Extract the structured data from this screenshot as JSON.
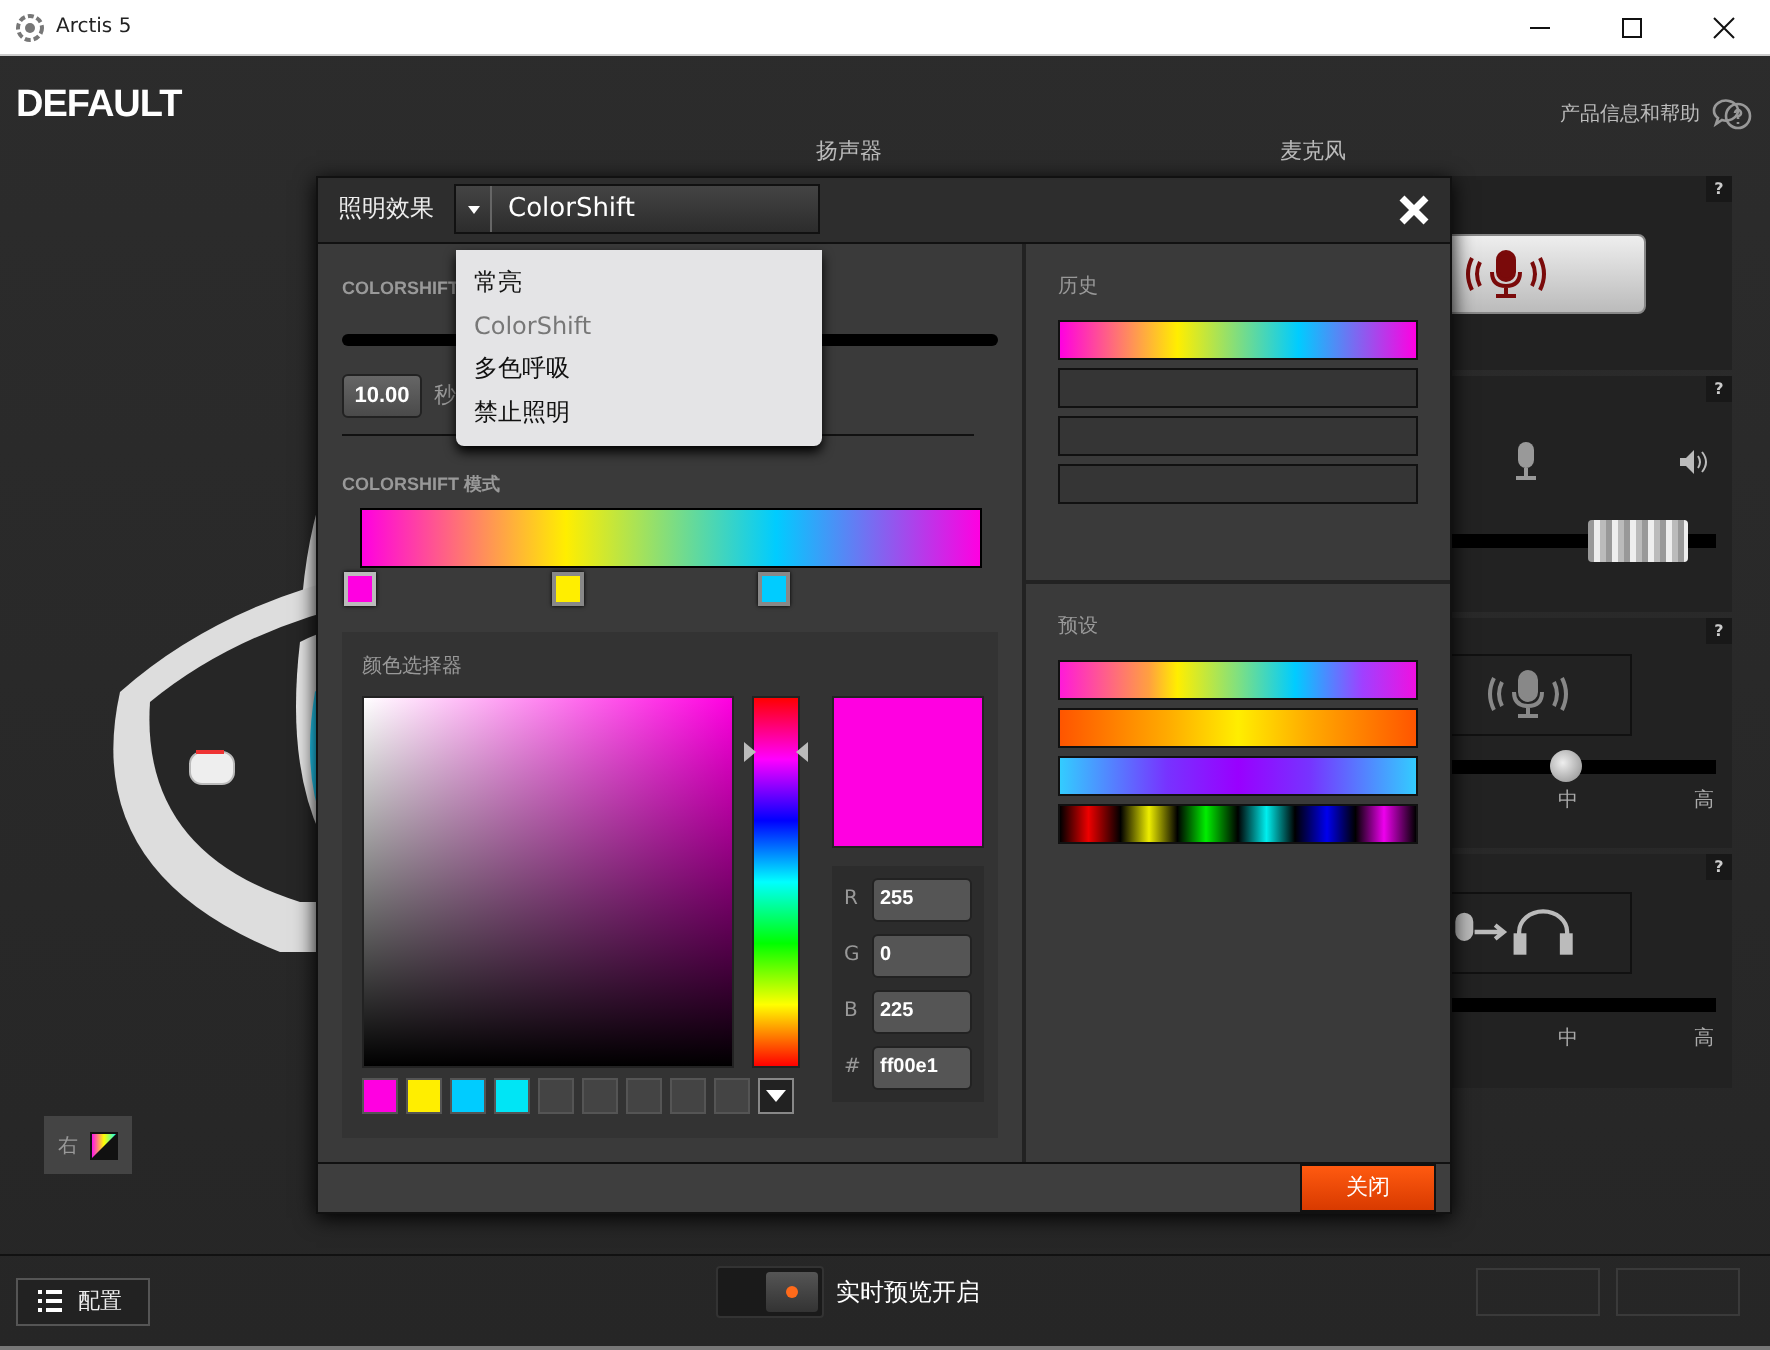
{
  "window": {
    "title": "Arctis 5"
  },
  "profile": {
    "name": "DEFAULT"
  },
  "help_link": "产品信息和帮助",
  "column_headings": [
    "扬声器",
    "麦克风"
  ],
  "mic_panels": [
    {
      "kind": "mute",
      "help": "?"
    },
    {
      "kind": "volume",
      "help": "?",
      "level": 0.86
    },
    {
      "kind": "noise",
      "help": "?",
      "level": 0.73,
      "ticks": [
        "中",
        "高"
      ]
    },
    {
      "kind": "sidetone",
      "help": "?",
      "ticks": [
        "中",
        "高"
      ]
    }
  ],
  "zone": {
    "label": "右"
  },
  "footer": {
    "config_button": "配置",
    "preview": {
      "label": "实时预览开启",
      "on": true
    }
  },
  "dialog": {
    "title": "照明效果",
    "effect": {
      "value": "ColorShift",
      "options": [
        {
          "label": "常亮",
          "selected": false
        },
        {
          "label": "ColorShift",
          "selected": true
        },
        {
          "label": "多色呼吸",
          "selected": false
        },
        {
          "label": "禁止照明",
          "selected": false
        }
      ]
    },
    "speed": {
      "label": "COLORSHIFT",
      "value": "10.00",
      "unit": "秒"
    },
    "mode": {
      "label": "COLORSHIFT 模式",
      "stops": [
        {
          "color": "#ff00e1",
          "selected": true
        },
        {
          "color": "#ffee00",
          "selected": false
        },
        {
          "color": "#00ccff",
          "selected": false
        }
      ]
    },
    "picker": {
      "label": "颜色选择器",
      "hue_slider": {
        "level": 0.85
      },
      "fields": [
        {
          "label": "R",
          "value": "255"
        },
        {
          "label": "G",
          "value": "0"
        },
        {
          "label": "B",
          "value": "225"
        },
        {
          "label": "#",
          "value": "ff00e1"
        }
      ],
      "swatches": [
        {
          "kind": "color",
          "color": "#ff00e1"
        },
        {
          "kind": "color",
          "color": "#ffee00"
        },
        {
          "kind": "color",
          "color": "#00ccff"
        },
        {
          "kind": "color",
          "color": "#00e5f5"
        },
        {
          "kind": "empty"
        },
        {
          "kind": "empty"
        },
        {
          "kind": "empty"
        },
        {
          "kind": "empty"
        },
        {
          "kind": "empty"
        }
      ]
    },
    "history": {
      "label": "历史",
      "slots": [
        {
          "kind": "gradient"
        },
        {
          "kind": "empty"
        },
        {
          "kind": "empty"
        },
        {
          "kind": "empty"
        }
      ]
    },
    "presets": {
      "label": "预设",
      "items": [
        {
          "kind": "rainbow"
        },
        {
          "kind": "warm"
        },
        {
          "kind": "cool"
        },
        {
          "kind": "bands"
        }
      ]
    },
    "close_button": "关闭"
  }
}
